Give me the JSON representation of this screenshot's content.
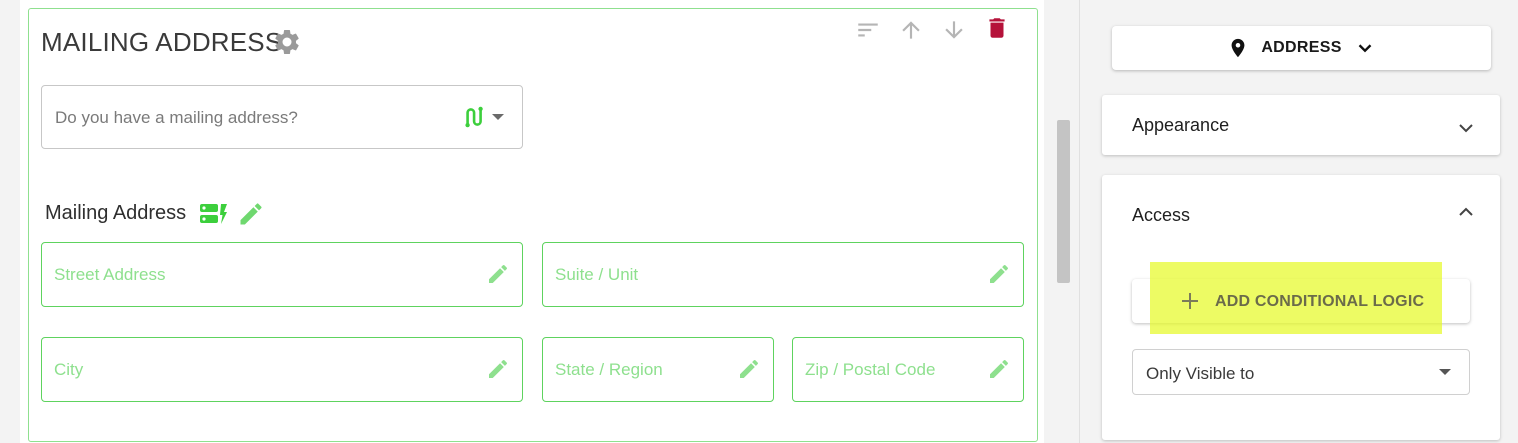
{
  "section": {
    "title": "MAILING ADDRESS"
  },
  "question": {
    "placeholder": "Do you have a mailing address?"
  },
  "group": {
    "label": "Mailing Address"
  },
  "fields": [
    {
      "label": "Street Address"
    },
    {
      "label": "Suite / Unit"
    },
    {
      "label": "City"
    },
    {
      "label": "State / Region"
    },
    {
      "label": "Zip / Postal Code"
    }
  ],
  "right_panel": {
    "type_button": "ADDRESS",
    "appearance": "Appearance",
    "access": "Access",
    "conditional_logic": "ADD CONDITIONAL LOGIC",
    "visibility_select": "Only Visible to"
  },
  "colors": {
    "field_border": "#5ed35e",
    "field_label": "#8ee08e",
    "delete_icon": "#b5123a",
    "highlight": "#e6fa28"
  },
  "icons": {
    "section_settings": "gear-icon",
    "sort": "sort-icon",
    "move_up": "arrow-up-icon",
    "move_down": "arrow-down-icon",
    "delete": "trash-icon",
    "branch": "branch-logic-icon",
    "group": "field-group-icon",
    "edit": "pencil-icon",
    "location": "location-pin-icon",
    "add": "plus-icon"
  }
}
